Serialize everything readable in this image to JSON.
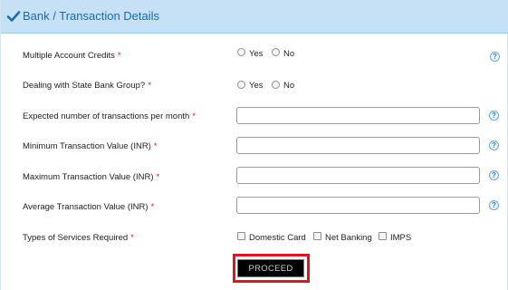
{
  "section": {
    "title": "Bank / Transaction Details",
    "icon": "checkmark-icon"
  },
  "required_marker": "*",
  "help_glyph": "?",
  "fields": {
    "multiple_account_credits": {
      "label": "Multiple Account Credits",
      "options": [
        "Yes",
        "No"
      ]
    },
    "state_bank_group": {
      "label": "Dealing with State Bank Group?",
      "options": [
        "Yes",
        "No"
      ]
    },
    "expected_transactions": {
      "label": "Expected number of transactions per month",
      "value": ""
    },
    "min_transaction": {
      "label": "Minimum Transaction Value (INR)",
      "value": ""
    },
    "max_transaction": {
      "label": "Maximum Transaction Value (INR)",
      "value": ""
    },
    "avg_transaction": {
      "label": "Average Transaction Value (INR)",
      "value": ""
    },
    "services": {
      "label": "Types of Services Required",
      "options": [
        "Domestic Card",
        "Net Banking",
        "IMPS"
      ]
    }
  },
  "actions": {
    "proceed": "PROCEED"
  },
  "colors": {
    "header_bg": "#c6e0f5",
    "header_text": "#1a6bb0",
    "required": "#cc1f1f",
    "proceed_bg": "#000000",
    "highlight": "#e3121c"
  }
}
